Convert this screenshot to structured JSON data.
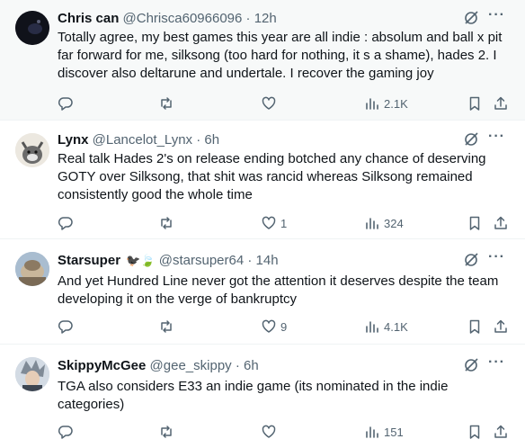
{
  "posts": [
    {
      "name": "Chris can",
      "emoji": "",
      "handle": "@Chrisca60966096",
      "sep": "·",
      "time": "12h",
      "text": "Totally agree, my best games this year are all indie : absolum and ball x pit far forward for me, silksong (too hard for nothing, it s a shame), hades 2. I discover also deltarune and undertale. I recover the gaming joy",
      "reply_count": "",
      "repost_count": "",
      "like_count": "",
      "views": "2.1K"
    },
    {
      "name": "Lynx",
      "emoji": "",
      "handle": "@Lancelot_Lynx",
      "sep": "·",
      "time": "6h",
      "text": "Real talk Hades 2's on release ending botched any chance of deserving GOTY over Silksong, that shit was rancid whereas Silksong remained consistently good the whole time",
      "reply_count": "",
      "repost_count": "",
      "like_count": "1",
      "views": "324"
    },
    {
      "name": "Starsuper",
      "emoji": "🐦‍⬛🍃",
      "handle": "@starsuper64",
      "sep": "·",
      "time": "14h",
      "text": "And yet Hundred Line never got the attention it deserves despite the team developing it on the verge of bankruptcy",
      "reply_count": "",
      "repost_count": "",
      "like_count": "9",
      "views": "4.1K"
    },
    {
      "name": "SkippyMcGee",
      "emoji": "",
      "handle": "@gee_skippy",
      "sep": "·",
      "time": "6h",
      "text": "TGA also considers E33 an indie game (its nominated in the indie categories)",
      "reply_count": "",
      "repost_count": "",
      "like_count": "",
      "views": "151"
    }
  ],
  "icons": {
    "reply": "reply-icon",
    "repost": "repost-icon",
    "like": "like-icon",
    "views": "views-icon",
    "bookmark": "bookmark-icon",
    "share": "share-icon",
    "grok": "grok-icon",
    "more": "more-icon"
  },
  "colors": {
    "text": "#0f1419",
    "muted": "#536471",
    "divider": "#eff3f4",
    "highlight_bg": "#f7f9f9"
  }
}
